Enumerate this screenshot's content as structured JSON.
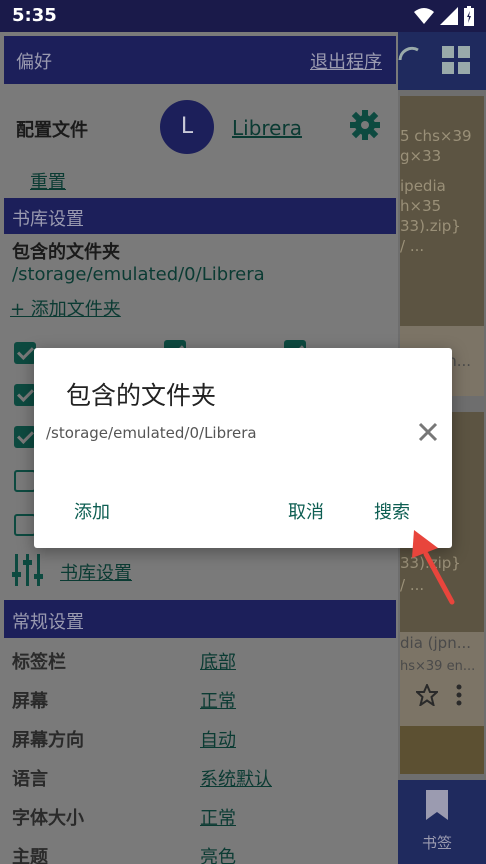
{
  "status": {
    "time": "5:35"
  },
  "drawer": {
    "header_title": "偏好",
    "exit_label": "退出程序",
    "profile_label": "配置文件",
    "avatar_letter": "L",
    "profile_name": "Librera",
    "reset_label": "重置",
    "library_section": "书库设置",
    "included_folders_label": "包含的文件夹",
    "included_folder_path": "/storage/emulated/0/Librera",
    "add_folder_label": "+ 添加文件夹",
    "library_settings_link": "书库设置",
    "general_section": "常规设置",
    "settings": [
      {
        "label": "标签栏",
        "value": "底部"
      },
      {
        "label": "屏幕",
        "value": "正常"
      },
      {
        "label": "屏幕方向",
        "value": "自动"
      },
      {
        "label": "语言",
        "value": "系统默认"
      },
      {
        "label": "字体大小",
        "value": "正常"
      },
      {
        "label": "主题",
        "value": "亮色"
      }
    ]
  },
  "background_app": {
    "card1_lines": [
      "5 chs×39",
      "g×33",
      "",
      "ipedia",
      "h×35",
      "33).zip}",
      "/ ..."
    ],
    "card1_caption": "dia (jpn...",
    "card2_lines": [
      "33).zip}",
      "/ ..."
    ],
    "card2_caption": "dia (jpn...",
    "card2_meta": "hs×39 en...",
    "bookmark_label": "书签"
  },
  "dialog": {
    "title": "包含的文件夹",
    "path": "/storage/emulated/0/Librera",
    "add_button": "添加",
    "cancel_button": "取消",
    "search_button": "搜索"
  },
  "colors": {
    "accent": "#0d5e52",
    "header_bg": "#1c1f5a",
    "arrow": "#e8453c"
  }
}
